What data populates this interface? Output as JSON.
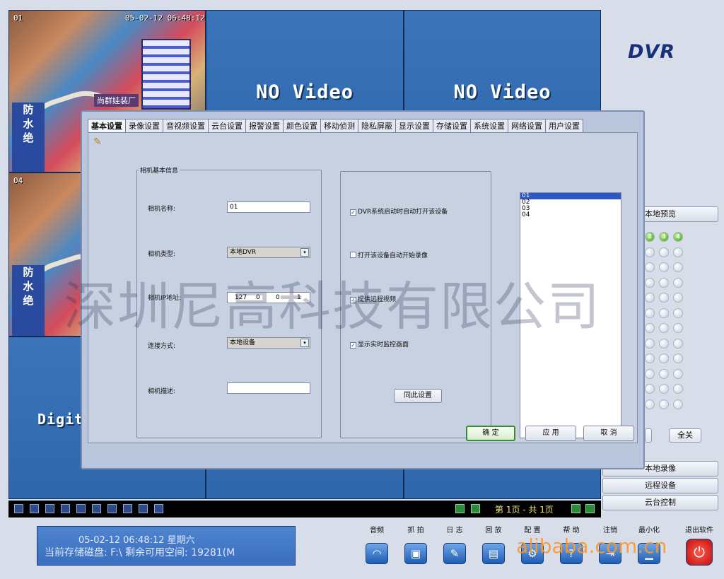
{
  "brand": "DVR",
  "grid": {
    "cells": [
      {
        "label": "01",
        "timestamp": "05-02-12  06:48:12",
        "sign": "尚群娃装厂",
        "pole_chars": [
          "防",
          "水",
          "绝"
        ]
      },
      {
        "no_video": "NO Video"
      },
      {
        "no_video": "NO Video"
      },
      {
        "label": "04",
        "pole_chars": [
          "防",
          "水",
          "绝"
        ]
      },
      {
        "no_video": "Digita"
      }
    ]
  },
  "side": {
    "local_preview": "本地预览",
    "channel_badges": [
      "2",
      "3",
      "4"
    ],
    "all_off": "全关",
    "local_record": "本地录像",
    "remote_device": "远程设备",
    "ptz_control": "云台控制"
  },
  "strip": {
    "page_text": "第 1页 - 共 1页"
  },
  "status": {
    "line1": "05-02-12    06:48:12       星期六",
    "line2": "当前存储磁盘: F:\\     剩余可用空间: 19281(M"
  },
  "toolbar": [
    {
      "label": "音频",
      "icon": "headphones-icon"
    },
    {
      "label": "抓 拍",
      "icon": "camera-icon"
    },
    {
      "label": "日 志",
      "icon": "pen-icon"
    },
    {
      "label": "回 放",
      "icon": "playback-icon"
    },
    {
      "label": "配 置",
      "icon": "settings-icon"
    },
    {
      "label": "帮 助",
      "icon": "help-icon"
    },
    {
      "label": "注销",
      "icon": "logout-icon"
    },
    {
      "label": "最小化",
      "icon": "minimize-icon"
    },
    {
      "label": "退出软件",
      "icon": "power-icon"
    }
  ],
  "dialog": {
    "tabs": [
      "基本设置",
      "录像设置",
      "音视频设置",
      "云台设置",
      "报警设置",
      "颜色设置",
      "移动侦测",
      "隐私屏蔽",
      "显示设置",
      "存储设置",
      "系统设置",
      "网络设置",
      "用户设置"
    ],
    "group_title": "相机基本信息",
    "camera_name_label": "相机名称:",
    "camera_name_value": "01",
    "camera_type_label": "相机类型:",
    "camera_type_value": "本地DVR",
    "camera_ip_label": "相机IP地址:",
    "ip": [
      "127",
      "0",
      "0",
      "1"
    ],
    "connect_label": "连接方式:",
    "connect_value": "本地设备",
    "desc_label": "相机描述:",
    "desc_value": "",
    "checks": [
      {
        "label": "DVR系统启动时自动打开该设备",
        "checked": true
      },
      {
        "label": "打开该设备自动开始录像",
        "checked": false
      },
      {
        "label": "提供远程视频",
        "checked": true
      },
      {
        "label": "显示实时监控画面",
        "checked": true
      }
    ],
    "sync_button": "同此设置",
    "device_list": [
      "01",
      "02",
      "03",
      "04"
    ],
    "ok": "确  定",
    "apply": "应  用",
    "cancel": "取  消"
  },
  "watermark_cn": "深圳尼高科技有限公司",
  "watermark_site": "alibaba.com.cn"
}
